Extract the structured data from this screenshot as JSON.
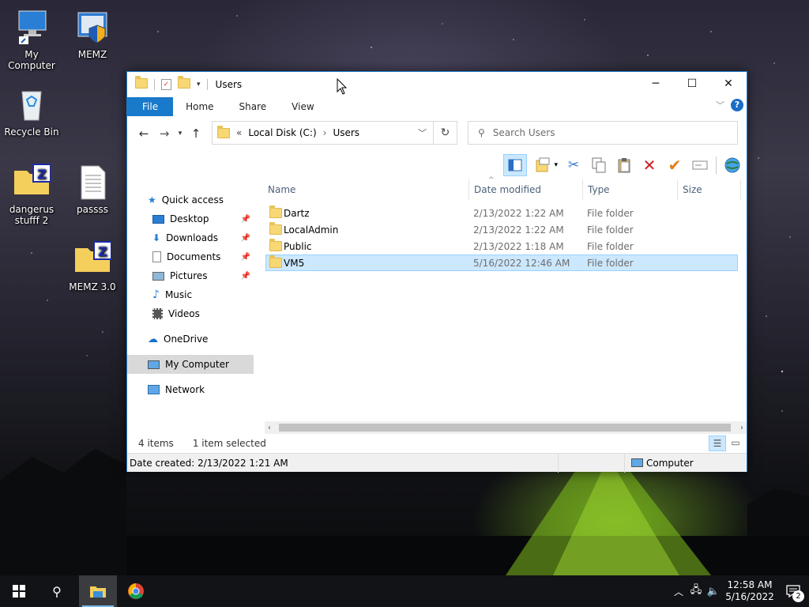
{
  "desktop": {
    "icons": [
      {
        "label": "My Computer"
      },
      {
        "label": "MEMZ"
      },
      {
        "label": "Recycle Bin"
      },
      {
        "label": "dangerus stufff 2"
      },
      {
        "label": "passss"
      },
      {
        "label": "MEMZ 3.0"
      }
    ]
  },
  "window": {
    "title": "Users",
    "ribbon_tabs": [
      "File",
      "Home",
      "Share",
      "View"
    ],
    "help_label": "?",
    "address": {
      "chevron": "«",
      "crumbs": [
        "Local Disk (C:)",
        "Users"
      ],
      "separator": "›"
    },
    "search_placeholder": "Search Users",
    "nav": {
      "quick_access": "Quick access",
      "items": [
        {
          "label": "Desktop"
        },
        {
          "label": "Downloads"
        },
        {
          "label": "Documents"
        },
        {
          "label": "Pictures"
        },
        {
          "label": "Music"
        },
        {
          "label": "Videos"
        }
      ],
      "onedrive": "OneDrive",
      "my_computer": "My Computer",
      "network": "Network"
    },
    "columns": {
      "name": "Name",
      "date": "Date modified",
      "type": "Type",
      "size": "Size"
    },
    "files": [
      {
        "name": "Dartz",
        "date": "2/13/2022 1:22 AM",
        "type": "File folder"
      },
      {
        "name": "LocalAdmin",
        "date": "2/13/2022 1:22 AM",
        "type": "File folder"
      },
      {
        "name": "Public",
        "date": "2/13/2022 1:18 AM",
        "type": "File folder"
      },
      {
        "name": "VM5",
        "date": "5/16/2022 12:46 AM",
        "type": "File folder"
      }
    ],
    "status": {
      "count": "4 items",
      "selected": "1 item selected"
    },
    "details": {
      "date_created": "Date created: 2/13/2022 1:21 AM",
      "location": "Computer"
    }
  },
  "taskbar": {
    "time": "12:58 AM",
    "date": "5/16/2022",
    "notifications": "2"
  },
  "colors": {
    "accent": "#1979ca",
    "selection": "#cce8ff",
    "folder": "#f8d775"
  }
}
